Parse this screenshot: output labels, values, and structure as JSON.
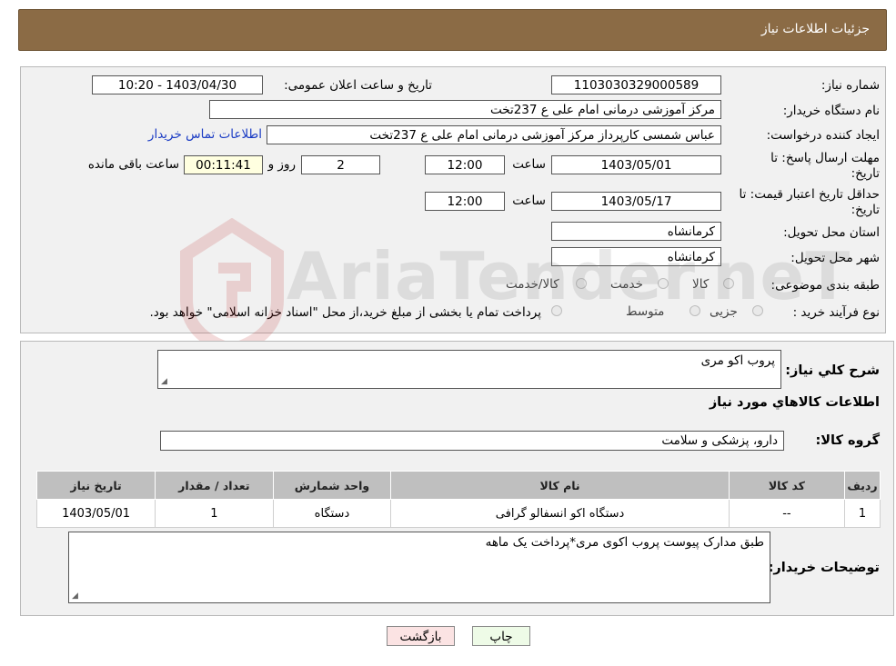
{
  "header": {
    "title": "جزئیات اطلاعات نیاز"
  },
  "form": {
    "need_number_label": "شماره نیاز:",
    "need_number": "1103030329000589",
    "announce_label": "تاریخ و ساعت اعلان عمومی:",
    "announce_value": "1403/04/30 - 10:20",
    "buyer_org_label": "نام دستگاه خریدار:",
    "buyer_org": "مرکز آموزشی درمانی امام علی ع 237تخت",
    "requester_label": "ایجاد کننده درخواست:",
    "requester": "عباس شمسی کارپرداز  مرکز آموزشی درمانی امام علی ع 237تخت",
    "contact_link": "اطلاعات تماس خریدار",
    "deadline_label_1": "مهلت ارسال پاسخ: تا",
    "deadline_label_2": "تاریخ:",
    "deadline_date": "1403/05/01",
    "time_label": "ساعت",
    "deadline_time": "12:00",
    "days_value": "2",
    "days_label": "روز و",
    "remaining_time": "00:11:41",
    "remaining_label": "ساعت باقی مانده",
    "validity_label_1": "حداقل تاریخ اعتبار قیمت: تا",
    "validity_label_2": "تاریخ:",
    "validity_date": "1403/05/17",
    "validity_time": "12:00",
    "province_label": "استان محل تحویل:",
    "province": "کرمانشاه",
    "city_label": "شهر محل تحویل:",
    "city": "کرمانشاه",
    "category_label": "طبقه بندی موضوعی:",
    "category_options": [
      "کالا",
      "خدمت",
      "کالا/خدمت"
    ],
    "purchase_type_label": "نوع فرآیند خرید :",
    "purchase_options": [
      "جزیی",
      "متوسط"
    ],
    "purchase_note": "پرداخت تمام یا بخشی از مبلغ خرید،از محل \"اسناد خزانه اسلامی\" خواهد بود."
  },
  "watermark": {
    "text": "AriaTender.neT"
  },
  "details": {
    "summary_label": "شرح کلي نياز:",
    "summary": "پروب اکو مری",
    "goods_info_heading": "اطلاعات کالاهاي مورد نياز",
    "goods_group_label": "گروه کالا:",
    "goods_group": "دارو، پزشکی و سلامت",
    "table_headers": [
      "ردیف",
      "کد کالا",
      "نام کالا",
      "واحد شمارش",
      "تعداد / مقدار",
      "تاریخ نیاز"
    ],
    "table_rows": [
      [
        "1",
        "--",
        "دستگاه اکو انسفالو گرافی",
        "دستگاه",
        "1",
        "1403/05/01"
      ]
    ],
    "buyer_notes_label": "توضیحات خریدار:",
    "buyer_notes": "طبق مدارک پیوست پروب اکوی مری*پرداخت یک ماهه"
  },
  "buttons": {
    "print": "چاپ",
    "back": "بازگشت"
  },
  "colors": {
    "header_bg": "#8b6b45",
    "link": "#1a3bc4",
    "back_btn": "#fbe3e3",
    "print_btn": "#eefbe7"
  }
}
